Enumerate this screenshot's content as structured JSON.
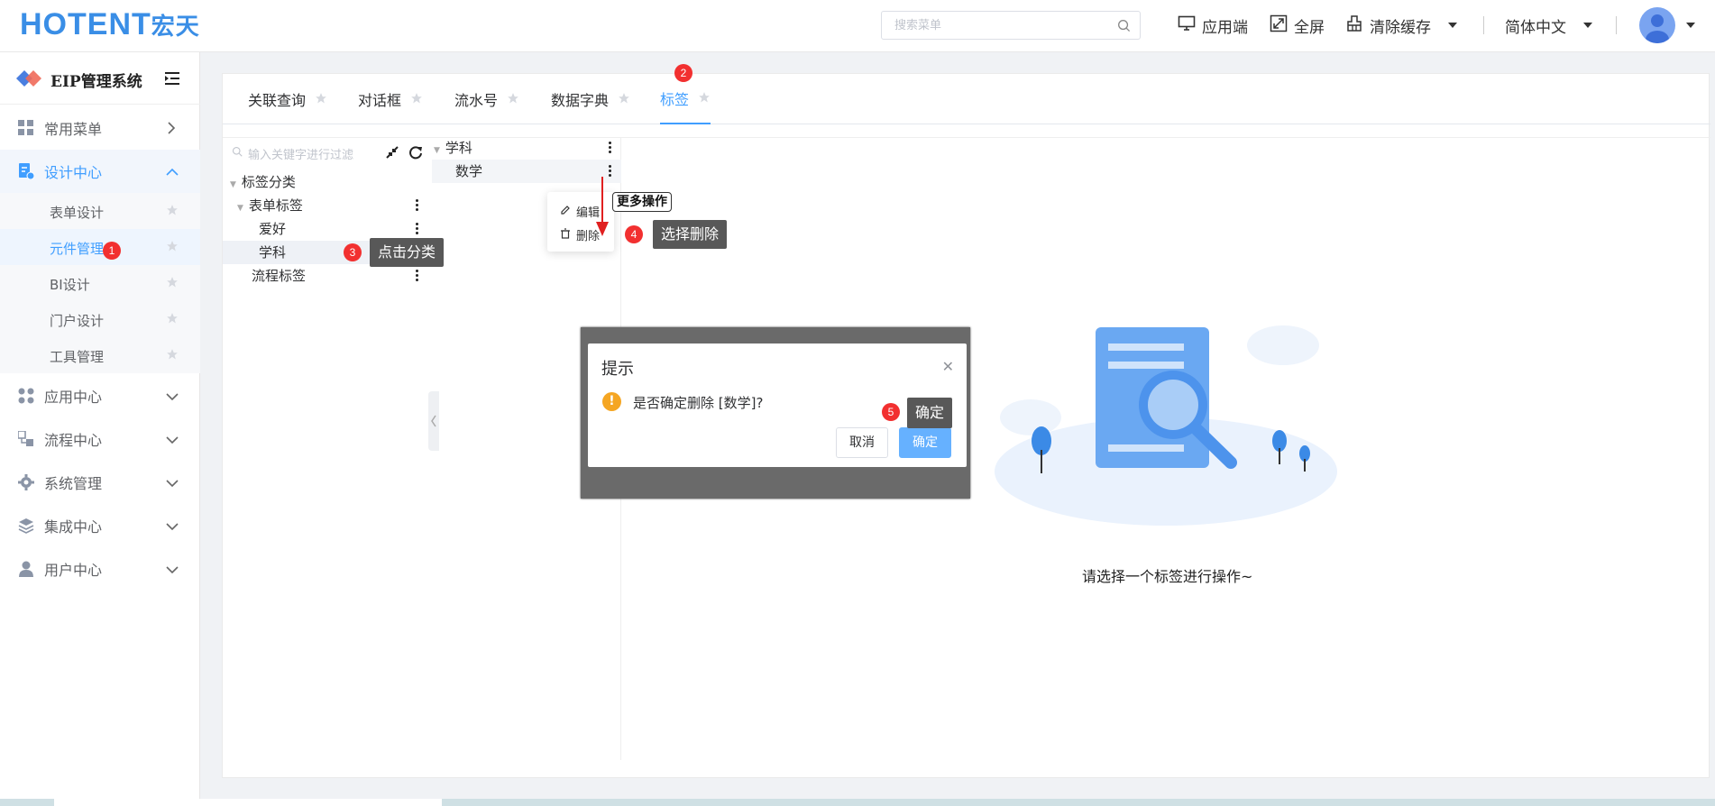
{
  "header": {
    "logo_main": "HOTENT",
    "logo_cn": "宏天",
    "search_placeholder": "搜索菜单",
    "app_label": "应用端",
    "fullscreen_label": "全屏",
    "clear_cache_label": "清除缓存",
    "language_label": "简体中文"
  },
  "sidebar": {
    "system_title": "EIP管理系统",
    "menus": [
      {
        "label": "常用菜单",
        "icon": "grid-icon"
      },
      {
        "label": "设计中心",
        "icon": "design-doc-icon"
      },
      {
        "label": "应用中心",
        "icon": "apps-icon"
      },
      {
        "label": "流程中心",
        "icon": "flow-icon"
      },
      {
        "label": "系统管理",
        "icon": "gear-icon"
      },
      {
        "label": "集成中心",
        "icon": "layers-icon"
      },
      {
        "label": "用户中心",
        "icon": "user-icon"
      }
    ],
    "design_sub": [
      "表单设计",
      "元件管理",
      "BI设计",
      "门户设计",
      "工具管理"
    ]
  },
  "tabs": [
    "关联查询",
    "对话框",
    "流水号",
    "数据字典",
    "标签"
  ],
  "tree": {
    "filter_placeholder": "输入关键字进行过滤",
    "root": "标签分类",
    "form_tags": "表单标签",
    "hobby": "爱好",
    "subject": "学科",
    "flow_tags": "流程标签"
  },
  "tree2": {
    "parent": "学科",
    "child": "数学"
  },
  "popover": {
    "edit": "编辑",
    "delete": "删除",
    "more_tip": "更多操作"
  },
  "steps": {
    "b1": "1",
    "b2": "2",
    "b3": "3",
    "b4": "4",
    "b5": "5",
    "tip3": "点击分类",
    "tip4": "选择删除",
    "tip5": "确定"
  },
  "empty_text": "请选择一个标签进行操作~",
  "dialog": {
    "title": "提示",
    "message": "是否确定删除 [数学]?",
    "cancel": "取消",
    "confirm": "确定"
  },
  "colors": {
    "accent": "#409eff",
    "badge": "#f23030",
    "tooltip": "#585858"
  }
}
